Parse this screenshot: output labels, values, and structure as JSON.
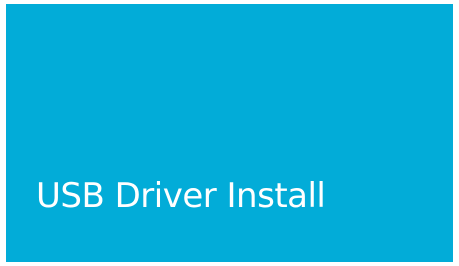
{
  "tile": {
    "label": "USB Driver Install",
    "background_color": "#02acd8",
    "text_color": "#ffffff"
  }
}
